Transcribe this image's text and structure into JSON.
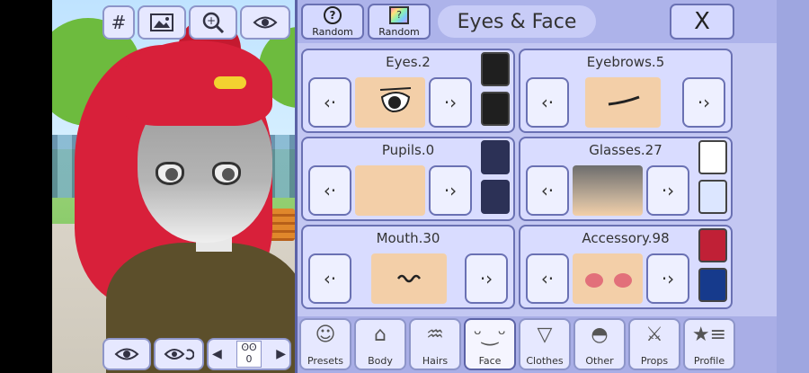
{
  "preview_toolbar": {
    "hash_label": "#",
    "zoom_label": "+"
  },
  "preview_bottom": {
    "slot_value": "0"
  },
  "header": {
    "random_label": "Random",
    "random_color_label": "Random",
    "random_color_glyph": "?",
    "title": "Eyes & Face",
    "close_label": "X"
  },
  "features": [
    {
      "name": "Eyes.2",
      "colors": [
        "#1f1f1f",
        "#1f1f1f"
      ]
    },
    {
      "name": "Eyebrows.5",
      "colors": []
    },
    {
      "name": "Pupils.0",
      "colors": [
        "#2c3156",
        "#2c3156"
      ]
    },
    {
      "name": "Glasses.27",
      "colors": [
        "#ffffff",
        "#dce6ff"
      ]
    },
    {
      "name": "Mouth.30",
      "colors": []
    },
    {
      "name": "Accessory.98",
      "colors": [
        "#c02036",
        "#163a8c"
      ]
    }
  ],
  "tabs": [
    {
      "label": "Presets",
      "icon": "person-icon"
    },
    {
      "label": "Body",
      "icon": "jacket-icon"
    },
    {
      "label": "Hairs",
      "icon": "hair-icon"
    },
    {
      "label": "Face",
      "icon": "face-icon",
      "active": true
    },
    {
      "label": "Clothes",
      "icon": "shirt-icon"
    },
    {
      "label": "Other",
      "icon": "cap-icon"
    },
    {
      "label": "Props",
      "icon": "sword-icon"
    },
    {
      "label": "Profile",
      "icon": "star-list-icon"
    }
  ]
}
